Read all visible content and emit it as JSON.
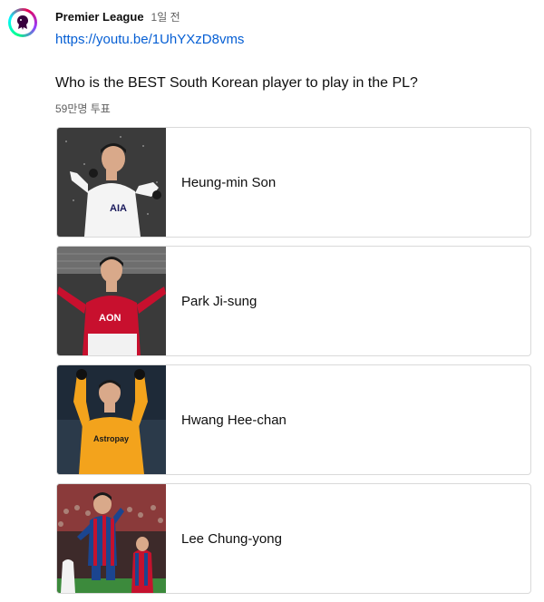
{
  "post": {
    "channel_name": "Premier League",
    "time_ago": "1일 전",
    "link": "https://youtu.be/1UhYXzD8vms",
    "question": "Who is the BEST South Korean player to play in the PL?",
    "vote_count": "59만명 투표"
  },
  "poll": {
    "options": [
      {
        "label": "Heung-min Son"
      },
      {
        "label": "Park Ji-sung"
      },
      {
        "label": "Hwang Hee-chan"
      },
      {
        "label": "Lee Chung-yong"
      }
    ]
  },
  "colors": {
    "link": "#065fd4",
    "border": "#d9d9d9",
    "secondary_text": "#606060",
    "pl_purple": "#38003c"
  }
}
